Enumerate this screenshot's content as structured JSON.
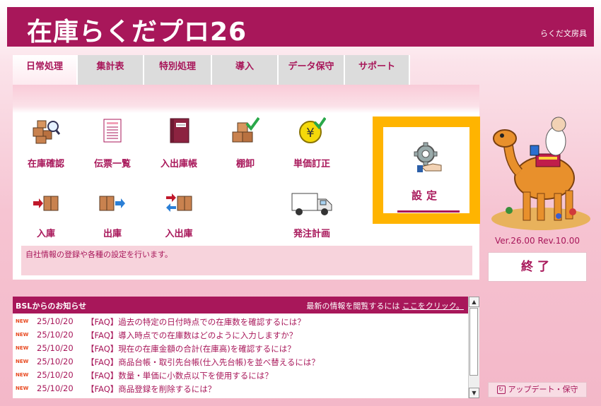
{
  "app": {
    "logo_text": "在庫らくだプロ26",
    "brand": "らくだ文房具"
  },
  "tabs": [
    {
      "label": "日常処理",
      "active": true
    },
    {
      "label": "集計表"
    },
    {
      "label": "特別処理"
    },
    {
      "label": "導入"
    },
    {
      "label": "データ保守"
    },
    {
      "label": "サポート"
    }
  ],
  "functions": [
    {
      "label": "在庫確認",
      "icon": "boxes-magnifier-icon"
    },
    {
      "label": "伝票一覧",
      "icon": "document-list-icon"
    },
    {
      "label": "入出庫帳",
      "icon": "ledger-book-icon"
    },
    {
      "label": "棚卸",
      "icon": "boxes-checkmark-icon"
    },
    {
      "label": "単価訂正",
      "icon": "yen-coin-icon"
    },
    {
      "label": "入庫",
      "icon": "box-arrow-in-icon"
    },
    {
      "label": "出庫",
      "icon": "box-arrow-out-icon"
    },
    {
      "label": "入出庫",
      "icon": "box-arrows-both-icon"
    },
    {
      "label": "発注計画",
      "icon": "delivery-truck-icon"
    }
  ],
  "settings": {
    "label": "設定",
    "icon": "gear-hand-icon"
  },
  "description": "自社情報の登録や各種の設定を行います。",
  "version": "Ver.26.00 Rev.10.00",
  "exit_label": "終了",
  "news": {
    "title": "BSLからのお知らせ",
    "link_prefix": "最新の情報を閲覧するには",
    "link_text": "ここをクリック。",
    "badge": "NEW",
    "items": [
      {
        "date": "25/10/20",
        "text": "【FAQ】過去の特定の日付時点での在庫数を確認するには？"
      },
      {
        "date": "25/10/20",
        "text": "【FAQ】導入時点での在庫数はどのように入力しますか？"
      },
      {
        "date": "25/10/20",
        "text": "【FAQ】現在の在庫金額の合計(在庫高)を確認するには？"
      },
      {
        "date": "25/10/20",
        "text": "【FAQ】商品台帳・取引先台帳(仕入先台帳)を並べ替えるには？"
      },
      {
        "date": "25/10/20",
        "text": "【FAQ】数量・単価に小数点以下を使用するには？"
      },
      {
        "date": "25/10/20",
        "text": "【FAQ】商品登録を削除するには？"
      }
    ]
  },
  "update_label": "アップデート・保守",
  "colors": {
    "brand": "#a8175a",
    "highlight": "#ffb400"
  }
}
